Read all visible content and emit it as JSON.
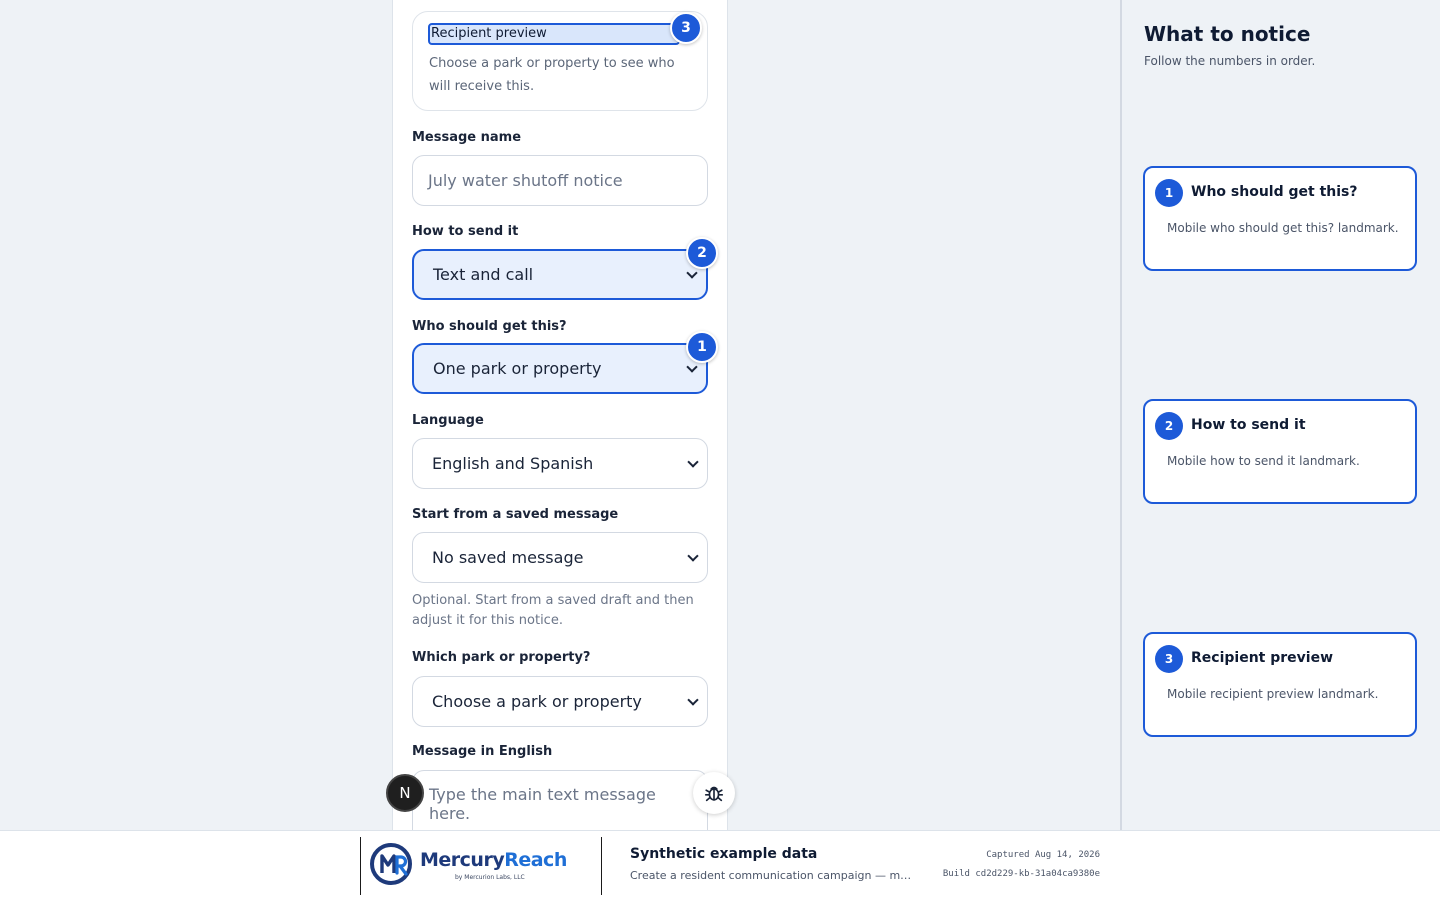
{
  "preview": {
    "title": "Recipient preview",
    "description": "Choose a park or property to see who will receive this."
  },
  "form": {
    "message_name": {
      "label": "Message name",
      "placeholder": "July water shutoff notice"
    },
    "send_method": {
      "label": "How to send it",
      "value": "Text and call"
    },
    "audience": {
      "label": "Who should get this?",
      "value": "One park or property"
    },
    "language": {
      "label": "Language",
      "value": "English and Spanish"
    },
    "saved_message": {
      "label": "Start from a saved message",
      "value": "No saved message",
      "helper": "Optional. Start from a saved draft and then adjust it for this notice."
    },
    "property": {
      "label": "Which park or property?",
      "value": "Choose a park or property"
    },
    "message_english": {
      "label": "Message in English",
      "placeholder": "Type the main text message here."
    }
  },
  "badges": {
    "audience": "1",
    "send_method": "2",
    "preview": "3"
  },
  "floating": {
    "n_button": "N"
  },
  "side": {
    "title": "What to notice",
    "subtitle": "Follow the numbers in order.",
    "notes": [
      {
        "num": "1",
        "title": "Who should get this?",
        "body": "Mobile who should get this? landmark."
      },
      {
        "num": "2",
        "title": "How to send it",
        "body": "Mobile how to send it landmark."
      },
      {
        "num": "3",
        "title": "Recipient preview",
        "body": "Mobile recipient preview landmark."
      }
    ]
  },
  "footer": {
    "brand_main": "Mercury",
    "brand_accent": "Reach",
    "brand_by": "by Mercurion Labs, LLC",
    "title": "Synthetic example data",
    "description": "Create a resident communication campaign — mobile...",
    "captured": "Captured Aug 14, 2026",
    "build": "Build cd2d229-kb-31a04ca9380e"
  },
  "colors": {
    "accent": "#1d5ad8",
    "highlight_fill": "#e8f0fd",
    "brand_dark": "#1e3a7b"
  }
}
